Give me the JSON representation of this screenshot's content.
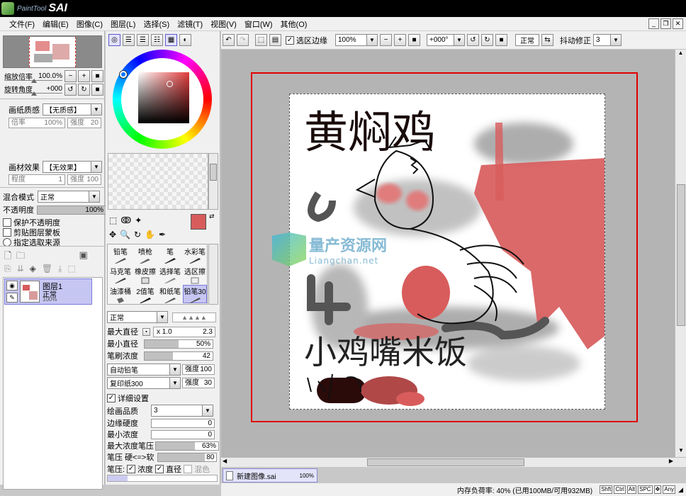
{
  "app": {
    "logo_small": "PaintTool",
    "logo_big": "SAI"
  },
  "menu": [
    "文件(F)",
    "编辑(E)",
    "图像(C)",
    "图层(L)",
    "选择(S)",
    "滤镜(T)",
    "视图(V)",
    "窗口(W)",
    "其他(O)"
  ],
  "navigator": {
    "zoom_label": "缩放倍率",
    "zoom_value": "100.0%",
    "rotate_label": "旋转角度",
    "rotate_value": "+000"
  },
  "paper": {
    "texture_label": "画纸质感",
    "texture_value": "【无质感】",
    "ratio_label": "倍率",
    "ratio_value": "100%",
    "strength_label": "强度",
    "strength_value": "20",
    "effect_label": "画材效果",
    "effect_value": "【无效果】",
    "degree_label": "程度",
    "degree_value": "1",
    "effect_strength_label": "强度",
    "effect_strength_value": "100"
  },
  "layer_props": {
    "blend_label": "混合模式",
    "blend_value": "正常",
    "opacity_label": "不透明度",
    "opacity_value": "100%",
    "protect_opacity": "保护不透明度",
    "clip_mask": "剪贴图层蒙板",
    "select_source": "指定选取来源"
  },
  "layers": [
    {
      "name": "图层1",
      "mode": "正常",
      "opacity": "100%"
    }
  ],
  "brushes": [
    {
      "label": "铅笔",
      "selected": false
    },
    {
      "label": "喷枪",
      "selected": false
    },
    {
      "label": "笔",
      "selected": false
    },
    {
      "label": "水彩笔",
      "selected": false
    },
    {
      "label": "马克笔",
      "selected": false
    },
    {
      "label": "橡皮擦",
      "selected": false
    },
    {
      "label": "选择笔",
      "selected": false
    },
    {
      "label": "选区擦",
      "selected": false
    },
    {
      "label": "油漆桶",
      "selected": false
    },
    {
      "label": "2值笔",
      "selected": false
    },
    {
      "label": "和纸笔",
      "selected": false
    },
    {
      "label": "铅笔30",
      "selected": true
    }
  ],
  "brush_settings": {
    "mode_value": "正常",
    "max_diameter_label": "最大直径",
    "max_diameter_mult": "x 1.0",
    "max_diameter_value": "2.3",
    "min_diameter_label": "最小直径",
    "min_diameter_value": "50%",
    "min_diameter_fraction": 0.5,
    "density_label": "笔刷浓度",
    "density_value": "42",
    "density_fraction": 0.42,
    "shape_value": "自动铅笔",
    "shape_strength_label": "强度",
    "shape_strength_value": "100",
    "texture_value": "复印纸300",
    "texture_strength_label": "强度",
    "texture_strength_value": "30",
    "detail_label": "详细设置",
    "quality_label": "绘画品质",
    "quality_value": "3",
    "edge_hardness_label": "边缘硬度",
    "edge_hardness_value": "0",
    "min_density_label": "最小浓度",
    "min_density_value": "0",
    "max_density_pressure_label": "最大浓度笔压",
    "max_density_pressure_value": "63%",
    "max_density_pressure_fraction": 0.63,
    "pressure_label": "笔压 硬<=>软",
    "pressure_value": "80",
    "pressure_fraction": 0.8,
    "pressure_row_label": "笔压:",
    "pressure_density": "浓度",
    "pressure_diameter": "直径",
    "pressure_blend": "混色"
  },
  "toolbar": {
    "selection_edge": "选区边缘",
    "zoom_value": "100%",
    "angle_value": "+000°",
    "mode_button": "正常",
    "stabilizer_label": "抖动修正",
    "stabilizer_value": "3"
  },
  "canvas": {
    "title_text": "黄焖鸡",
    "bottom_text": "小鸡嘴米饭",
    "watermark_cn": "量产资源网",
    "watermark_en": "Liangchan.net"
  },
  "doc_tab": {
    "name": "新建图像.sai",
    "zoom": "100%"
  },
  "status": {
    "memory": "内存负荷率: 40% (已用100MB/可用932MB)",
    "keys": [
      "Shft",
      "Ctrl",
      "Alt",
      "SPC"
    ],
    "any": "Any"
  },
  "colors": {
    "accent_red": "#d85c5c",
    "selected_layer": "#c6c6f3",
    "canvas_bg": "#b4b4b4"
  }
}
